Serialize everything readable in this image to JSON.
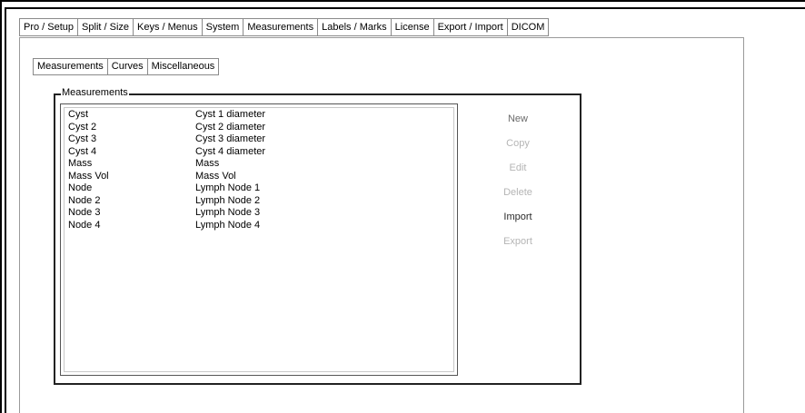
{
  "top_tabs": [
    {
      "label": "Pro / Setup"
    },
    {
      "label": "Split / Size"
    },
    {
      "label": "Keys / Menus"
    },
    {
      "label": "System"
    },
    {
      "label": "Measurements"
    },
    {
      "label": "Labels / Marks"
    },
    {
      "label": "License"
    },
    {
      "label": "Export / Import"
    },
    {
      "label": "DICOM"
    }
  ],
  "sub_tabs": [
    {
      "label": "Measurements"
    },
    {
      "label": "Curves"
    },
    {
      "label": "Miscellaneous"
    }
  ],
  "group": {
    "title": "Measurements"
  },
  "list": [
    {
      "name": "Cyst",
      "description": "Cyst 1 diameter"
    },
    {
      "name": "Cyst 2",
      "description": "Cyst 2 diameter"
    },
    {
      "name": "Cyst 3",
      "description": "Cyst 3 diameter"
    },
    {
      "name": "Cyst 4",
      "description": "Cyst 4 diameter"
    },
    {
      "name": "Mass",
      "description": "Mass"
    },
    {
      "name": "Mass Vol",
      "description": "Mass Vol"
    },
    {
      "name": "Node",
      "description": "Lymph Node 1"
    },
    {
      "name": "Node 2",
      "description": "Lymph Node 2"
    },
    {
      "name": "Node 3",
      "description": "Lymph Node 3"
    },
    {
      "name": "Node 4",
      "description": "Lymph Node 4"
    }
  ],
  "buttons": {
    "new": "New",
    "copy": "Copy",
    "edit": "Edit",
    "delete": "Delete",
    "import": "Import",
    "export": "Export"
  }
}
